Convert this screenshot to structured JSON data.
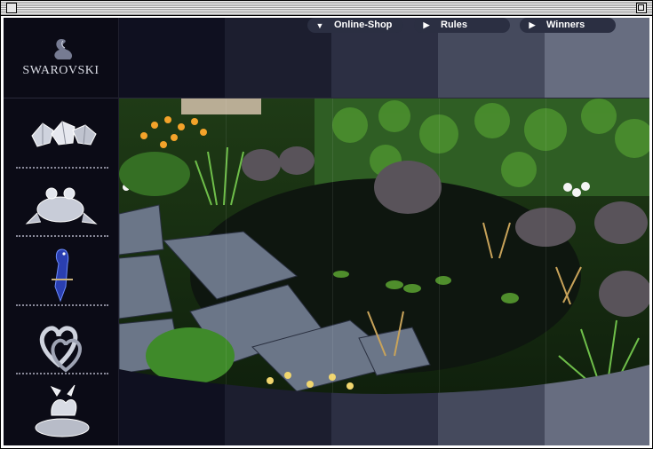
{
  "brand": {
    "name": "SWAROVSKI"
  },
  "nav": [
    {
      "label": "Online-Shop",
      "icon": "chevron-down-icon"
    },
    {
      "label": "Rules",
      "icon": "play-arrow-icon"
    },
    {
      "label": "Winners",
      "icon": "play-arrow-icon"
    }
  ],
  "sidebar": {
    "thumbnails": [
      {
        "name": "crystal-diamonds"
      },
      {
        "name": "crystal-frog"
      },
      {
        "name": "blue-parrot"
      },
      {
        "name": "crystal-hearts-ring"
      },
      {
        "name": "crystal-flower-leaf"
      }
    ]
  },
  "colors": {
    "background": "#0c0c1a",
    "nav_pill": "#2b2f42",
    "bands": [
      "#0c0c1a",
      "#1a1c2c",
      "#2a2d40",
      "#44495c",
      "#656b7e"
    ]
  }
}
